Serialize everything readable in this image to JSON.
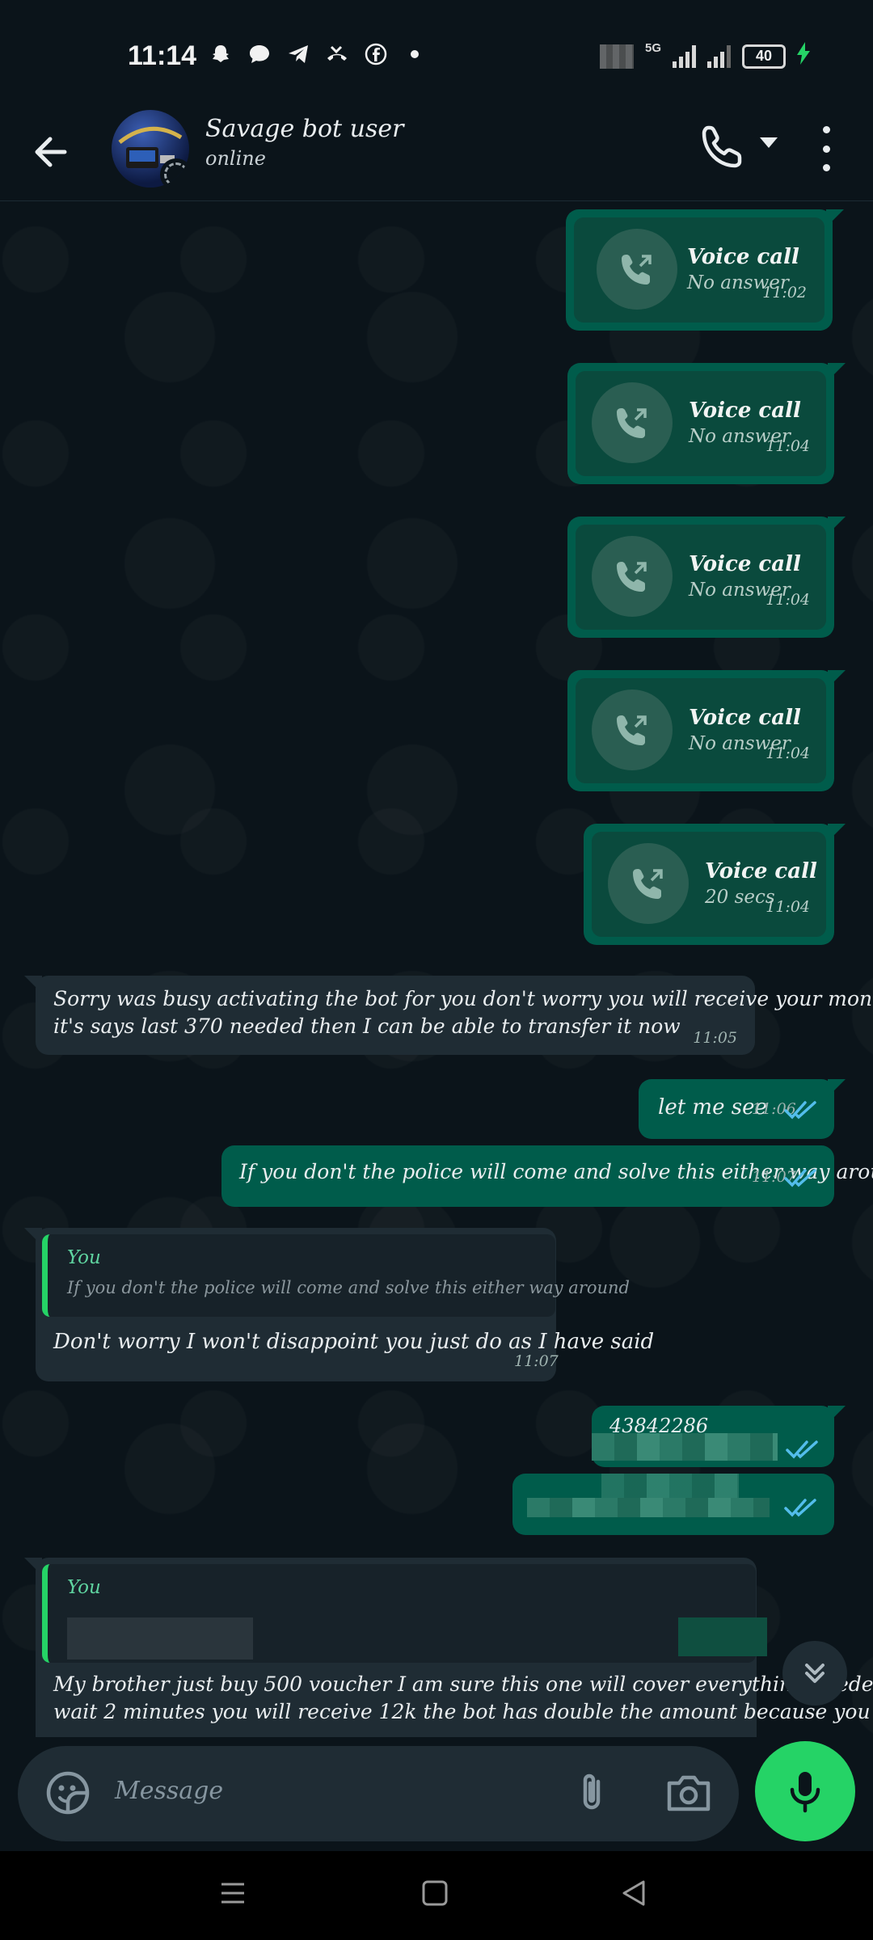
{
  "status_bar": {
    "time": "11:14",
    "network": "5G",
    "battery": "40"
  },
  "header": {
    "contact_name": "Savage bot user",
    "contact_status": "online"
  },
  "messages": {
    "calls": [
      {
        "title": "Voice call",
        "subtitle": "No answer",
        "time": "11:02"
      },
      {
        "title": "Voice call",
        "subtitle": "No answer",
        "time": "11:04"
      },
      {
        "title": "Voice call",
        "subtitle": "No answer",
        "time": "11:04"
      },
      {
        "title": "Voice call",
        "subtitle": "No answer",
        "time": "11:04"
      },
      {
        "title": "Voice call",
        "subtitle": "20 secs",
        "time": "11:04"
      }
    ],
    "in1": {
      "text_line1": "Sorry was busy activating the bot for you don't worry you will receive your money now",
      "text_line2": "it's says last 370 needed then I can be able to transfer it now",
      "time": "11:05"
    },
    "out1": {
      "text": "let me see",
      "time": "11:06"
    },
    "out2": {
      "text": "If you don't the police will come and solve this either way around",
      "time": "11:07"
    },
    "in2": {
      "quote_author": "You",
      "quote_text": "If you don't the police will come and solve this either way around",
      "text": "Don't worry I won't disappoint you just do as I have said",
      "time": "11:07"
    },
    "out3": {
      "text": "43842286"
    },
    "in3": {
      "quote_author": "You",
      "text_line1": "My brother just buy 500 voucher I am sure this one will cover everything needed then",
      "text_line2": "wait 2 minutes you will receive 12k the bot has double the amount because you have"
    }
  },
  "input": {
    "placeholder": "Message"
  },
  "colors": {
    "accent": "#25d366",
    "outgoing_bubble": "#005c4b",
    "incoming_bubble": "#1f2c34",
    "read_ticks": "#53bdeb",
    "background": "#0b141a"
  },
  "icons": [
    "back-arrow-icon",
    "phone-icon",
    "dropdown-caret-icon",
    "more-options-icon",
    "outgoing-call-icon",
    "read-ticks-icon",
    "emoji-sticker-icon",
    "attach-icon",
    "camera-icon",
    "mic-icon",
    "scroll-down-icon"
  ]
}
